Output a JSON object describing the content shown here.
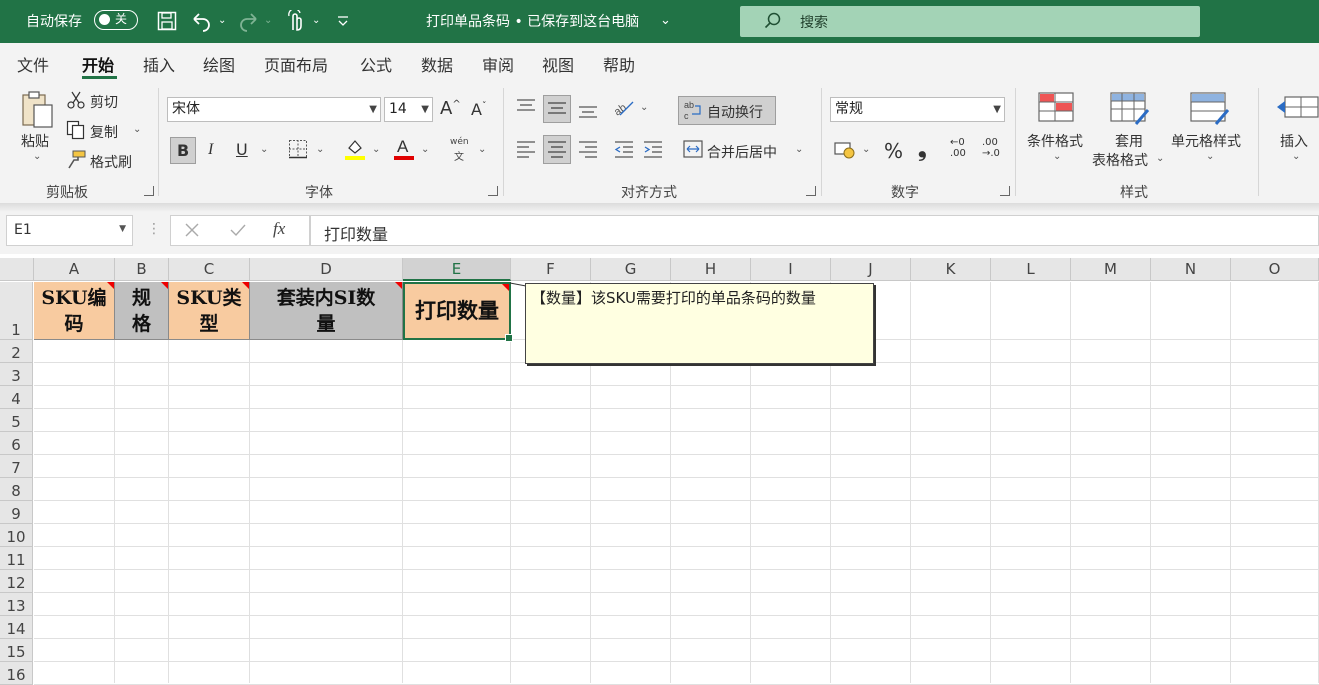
{
  "titlebar": {
    "autosave_label": "自动保存",
    "autosave_state": "关",
    "document_title": "打印单品条码 • 已保存到这台电脑",
    "search_placeholder": "搜索"
  },
  "menu": {
    "items": [
      "文件",
      "开始",
      "插入",
      "绘图",
      "页面布局",
      "公式",
      "数据",
      "审阅",
      "视图",
      "帮助"
    ],
    "active": "开始"
  },
  "ribbon": {
    "clipboard": {
      "paste": "粘贴",
      "cut": "剪切",
      "copy": "复制",
      "format_painter": "格式刷",
      "group_label": "剪贴板"
    },
    "font": {
      "font_name": "宋体",
      "font_size": "14",
      "bold": "B",
      "italic": "I",
      "underline": "U",
      "phonetic_top": "wén",
      "phonetic_bottom": "文",
      "group_label": "字体"
    },
    "alignment": {
      "wrap_text": "自动换行",
      "merge_center": "合并后居中",
      "group_label": "对齐方式"
    },
    "number": {
      "format": "常规",
      "percent": "%",
      "comma": "❟",
      "increase_decimal_top": "←0",
      "increase_decimal_bottom": ".00",
      "decrease_decimal_top": ".00",
      "decrease_decimal_bottom": "→.0",
      "group_label": "数字"
    },
    "styles": {
      "conditional_format": "条件格式",
      "table_format_line1": "套用",
      "table_format_line2": "表格格式",
      "cell_styles": "单元格样式",
      "group_label": "样式"
    },
    "cells": {
      "insert": "插入"
    }
  },
  "formula_bar": {
    "name_box": "E1",
    "fx": "fx",
    "content": "打印数量"
  },
  "sheet": {
    "columns": [
      "A",
      "B",
      "C",
      "D",
      "E",
      "F",
      "G",
      "H",
      "I",
      "J",
      "K",
      "L",
      "M",
      "N",
      "O"
    ],
    "rows": [
      "1",
      "2",
      "3",
      "4",
      "5",
      "6",
      "7",
      "8",
      "9",
      "10",
      "11",
      "12",
      "13",
      "14",
      "15",
      "16"
    ],
    "header_row": [
      {
        "line1": "SKU编",
        "line2": "码"
      },
      {
        "line1": "规",
        "line2": "格"
      },
      {
        "line1": "SKU类",
        "line2": "型"
      },
      {
        "line1": "套装内SI数",
        "line2": "量"
      },
      {
        "line1": "打印数量",
        "line2": ""
      }
    ],
    "comment": "【数量】该SKU需要打印的单品条码的数量"
  }
}
